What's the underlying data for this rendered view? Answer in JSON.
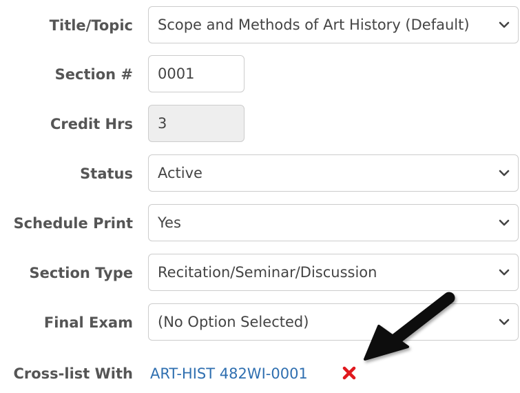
{
  "form": {
    "title_topic": {
      "label": "Title/Topic",
      "value": "Scope and Methods of Art History (Default)"
    },
    "section_number": {
      "label": "Section #",
      "value": "0001"
    },
    "credit_hrs": {
      "label": "Credit Hrs",
      "value": "3"
    },
    "status": {
      "label": "Status",
      "value": "Active"
    },
    "schedule_print": {
      "label": "Schedule Print",
      "value": "Yes"
    },
    "section_type": {
      "label": "Section Type",
      "value": "Recitation/Seminar/Discussion"
    },
    "final_exam": {
      "label": "Final Exam",
      "value": "(No Option Selected)"
    },
    "cross_list": {
      "label": "Cross-list With",
      "value": "ART-HIST 482WI-0001"
    }
  },
  "icons": {
    "chevron": "chevron-down-icon",
    "remove": "remove-x-icon",
    "arrow": "annotation-arrow-icon"
  },
  "colors": {
    "label": "#555555",
    "link": "#2f6fb0",
    "remove": "#e0191e",
    "border": "#cccccc",
    "readonly_bg": "#eeeeee",
    "arrow": "#111111"
  }
}
